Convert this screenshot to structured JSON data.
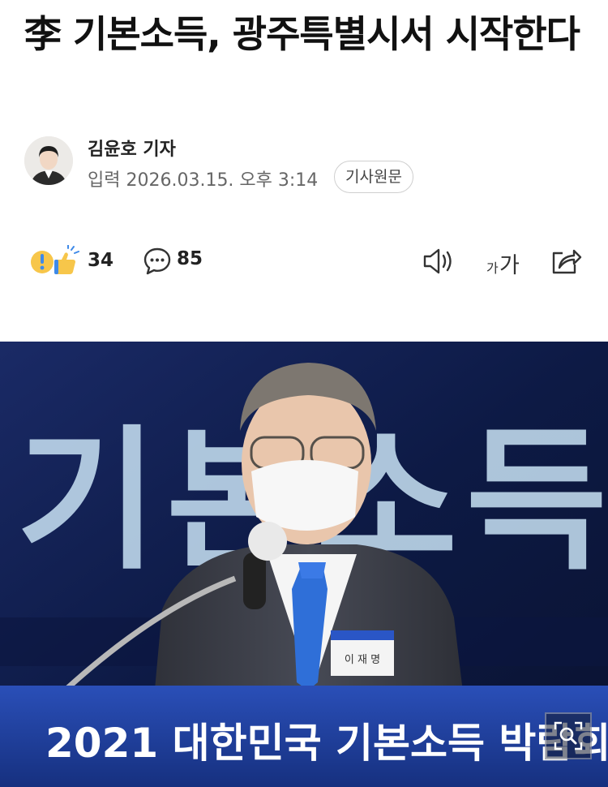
{
  "article": {
    "headline": "李 기본소득, 광주특별시서 시작한다",
    "reporter": "김윤호 기자",
    "published": "입력 2026.03.15. 오후 3:14",
    "source_button": "기사원문"
  },
  "actions": {
    "reaction_count": "34",
    "comment_count": "85",
    "font_size_label": "가가"
  },
  "photo": {
    "backdrop_text": "기본소득",
    "banner_text": "2021 대한민국 기본소득 박람회",
    "name_plate": "이 재 명"
  },
  "icons": [
    "reaction-icon",
    "comment-icon",
    "speaker-icon",
    "font-size-icon",
    "share-icon",
    "magnify-icon"
  ],
  "colors": {
    "backdrop": "#0a1738",
    "backdrop_text": "#c9e3f5",
    "banner": "#1d3c9a",
    "tie": "#2f6fd8",
    "reaction_yellow": "#f7c64a",
    "reaction_blue": "#3f8ae8"
  }
}
